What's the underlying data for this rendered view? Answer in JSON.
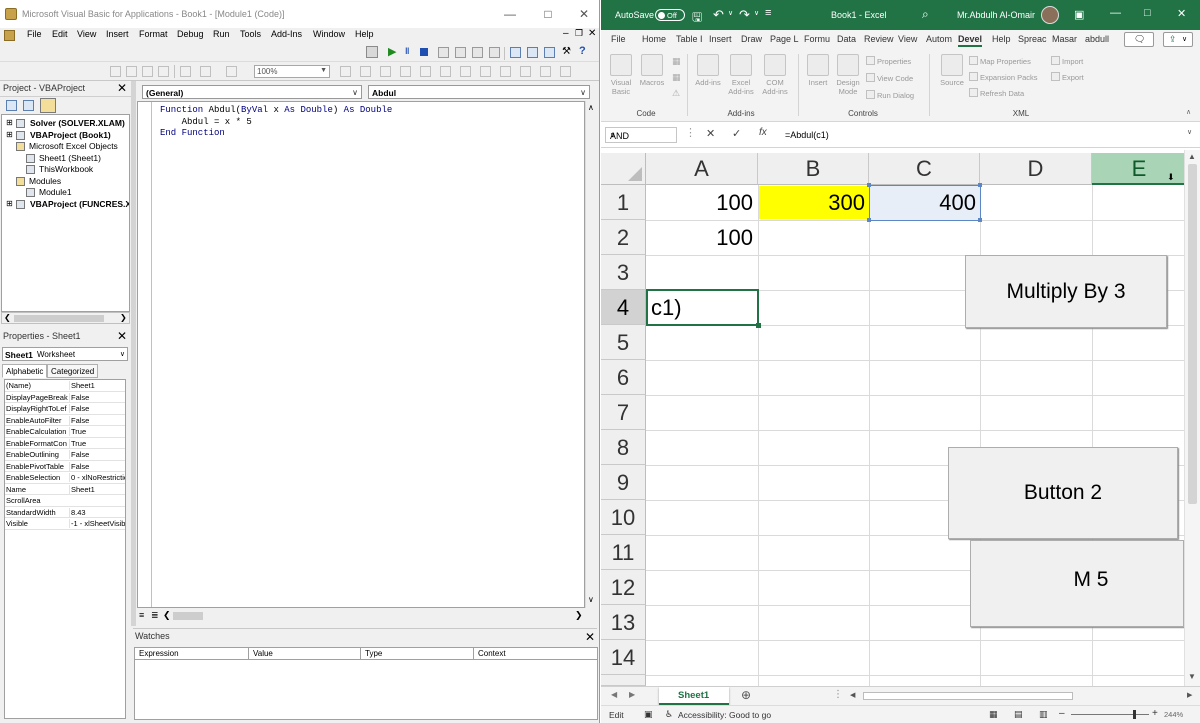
{
  "vba": {
    "title": "Microsoft Visual Basic for Applications - Book1 - [Module1 (Code)]",
    "menu": [
      "File",
      "Edit",
      "View",
      "Insert",
      "Format",
      "Debug",
      "Run",
      "Tools",
      "Add-Ins",
      "Window",
      "Help"
    ],
    "zoom": "100%",
    "project": {
      "title": "Project - VBAProject",
      "tree": [
        {
          "label": "Solver (SOLVER.XLAM)",
          "bold": true,
          "level": 0
        },
        {
          "label": "VBAProject (Book1)",
          "bold": true,
          "level": 0
        },
        {
          "label": "Microsoft Excel Objects",
          "bold": false,
          "level": 1
        },
        {
          "label": "Sheet1 (Sheet1)",
          "bold": false,
          "level": 2
        },
        {
          "label": "ThisWorkbook",
          "bold": false,
          "level": 2
        },
        {
          "label": "Modules",
          "bold": false,
          "level": 1
        },
        {
          "label": "Module1",
          "bold": false,
          "level": 2
        },
        {
          "label": "VBAProject (FUNCRES.XL",
          "bold": true,
          "level": 0
        }
      ]
    },
    "properties": {
      "title": "Properties - Sheet1",
      "object_name": "Sheet1",
      "object_type": "Worksheet",
      "tabs": [
        "Alphabetic",
        "Categorized"
      ],
      "rows": [
        [
          "(Name)",
          "Sheet1"
        ],
        [
          "DisplayPageBreak",
          "False"
        ],
        [
          "DisplayRightToLef",
          "False"
        ],
        [
          "EnableAutoFilter",
          "False"
        ],
        [
          "EnableCalculation",
          "True"
        ],
        [
          "EnableFormatCon",
          "True"
        ],
        [
          "EnableOutlining",
          "False"
        ],
        [
          "EnablePivotTable",
          "False"
        ],
        [
          "EnableSelection",
          "0 - xlNoRestrictio"
        ],
        [
          "Name",
          "Sheet1"
        ],
        [
          "ScrollArea",
          ""
        ],
        [
          "StandardWidth",
          "8.43"
        ],
        [
          "Visible",
          "-1 - xlSheetVisib"
        ]
      ]
    },
    "code": {
      "object_combo": "(General)",
      "proc_combo": "Abdul",
      "lines": [
        [
          {
            "t": "Function",
            "kw": true
          },
          {
            "t": " Abdul(",
            "kw": false
          },
          {
            "t": "ByVal",
            "kw": true
          },
          {
            "t": " x ",
            "kw": false
          },
          {
            "t": "As Double",
            "kw": true
          },
          {
            "t": ") ",
            "kw": false
          },
          {
            "t": "As Double",
            "kw": true
          }
        ],
        [
          {
            "t": "    Abdul = x * 5",
            "kw": false
          }
        ],
        [
          {
            "t": "End Function",
            "kw": true
          }
        ]
      ]
    },
    "watches": {
      "title": "Watches",
      "columns": [
        "Expression",
        "Value",
        "Type",
        "Context"
      ]
    }
  },
  "excel": {
    "autosave_label": "AutoSave",
    "autosave_state": "Off",
    "title": "Book1 - Excel",
    "user": "Mr.Abdulh Al-Omair",
    "tabs": [
      "File",
      "Home",
      "Table I",
      "Insert",
      "Draw",
      "Page L",
      "Formu",
      "Data",
      "Review",
      "View",
      "Autom",
      "Devel",
      "Help",
      "Spreac",
      "Masar",
      "abdull"
    ],
    "active_tab": "Devel",
    "ribbon": {
      "code_group": "Code",
      "addins_group": "Add-ins",
      "controls_group": "Controls",
      "xml_group": "XML",
      "visual_basic": "Visual Basic",
      "macros": "Macros",
      "addins": "Add-ins",
      "excel_addins": "Excel Add-ins",
      "com_addins": "COM Add-ins",
      "insert": "Insert",
      "design_mode": "Design Mode",
      "properties": "Properties",
      "view_code": "View Code",
      "run_dialog": "Run Dialog",
      "source": "Source",
      "map_properties": "Map Properties",
      "expansion_packs": "Expansion Packs",
      "refresh_data": "Refresh Data",
      "import": "Import",
      "export": "Export"
    },
    "name_box": "AND",
    "formula": "=Abdul(c1)",
    "columns": [
      "A",
      "B",
      "C",
      "D",
      "E"
    ],
    "rows": [
      "1",
      "2",
      "3",
      "4",
      "5",
      "6",
      "7",
      "8",
      "9",
      "10",
      "11",
      "12",
      "13",
      "14"
    ],
    "cells": {
      "A1": "100",
      "B1": "300",
      "C1": "400",
      "A2": "100",
      "A4": "c1)"
    },
    "buttons": {
      "multiply": "Multiply By 3",
      "button2": "Button 2",
      "m5": "M 5"
    },
    "sheet_tab": "Sheet1",
    "status_mode": "Edit",
    "accessibility": "Accessibility: Good to go",
    "zoom": "244%",
    "colors": {
      "excel_green": "#217346",
      "highlight_yellow": "#ffff00",
      "selected_cell_fill": "#e8eef8"
    }
  }
}
